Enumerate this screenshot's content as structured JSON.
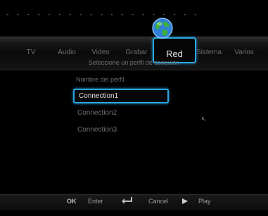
{
  "top_decoration": "- - - - - -  - - - -  - - - - - - - - -",
  "menu": {
    "items": [
      "TV",
      "Audio",
      "Video",
      "Grabar",
      "Red",
      "Sistema",
      "Varios"
    ],
    "active": "Red",
    "active_icon": "globe-icon"
  },
  "subtitle": "Seleccione un perfil de conexión",
  "profile_label": "Nombre del perfil",
  "connections": [
    "Connection1",
    "Connection2",
    "Connection3"
  ],
  "selected_connection": "Connection1",
  "footer": {
    "ok_label": "OK",
    "enter_label": "Enter",
    "cancel_label": "Cancel",
    "play_label": "Play"
  },
  "colors": {
    "accent": "#2aa7e0",
    "background": "#000000"
  }
}
